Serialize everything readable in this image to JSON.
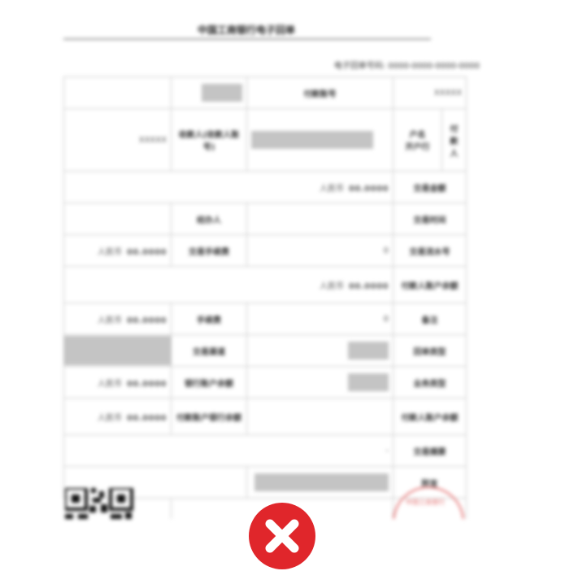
{
  "document": {
    "title": "中国工商银行电子回单",
    "serial_label": "电子回单号码:",
    "serial_value": "0000-0000-0000-0000",
    "masked_text": "XXXXX",
    "currency_prefix": "人民币",
    "amount": "00.0000",
    "zero_value": "0",
    "dash_value": "-",
    "rows": {
      "r1": {
        "l1": "付款账号",
        "l3": "收款账号"
      },
      "r2": {
        "l1": "付款人",
        "s1": "户名",
        "s2": "开户行",
        "l3": "收款人(收款人账号)"
      },
      "r3": {
        "l1": "交易金额"
      },
      "r4": {
        "l1": "交易时间",
        "l3": "经办人"
      },
      "r5": {
        "l1": "交易流水号",
        "l3": "交易手续费"
      },
      "r6": {
        "l1": "付款人账户余额"
      },
      "r7": {
        "l1": "备注",
        "l3": "手续费"
      },
      "r8": {
        "l1": "回单类型",
        "l3": "交易渠道"
      },
      "r9": {
        "l1": "业务类型",
        "l3": "银行账户余额"
      },
      "r10": {
        "l1": "付款人账户余额",
        "l3": "付款账户银行余额"
      },
      "r11": {
        "l1": "交易摘要"
      },
      "r12": {
        "l1": "附言"
      }
    },
    "seal_text": "中国工商银行"
  },
  "overlay": {
    "close_icon": "close-x-icon",
    "color": "#e0262b"
  }
}
